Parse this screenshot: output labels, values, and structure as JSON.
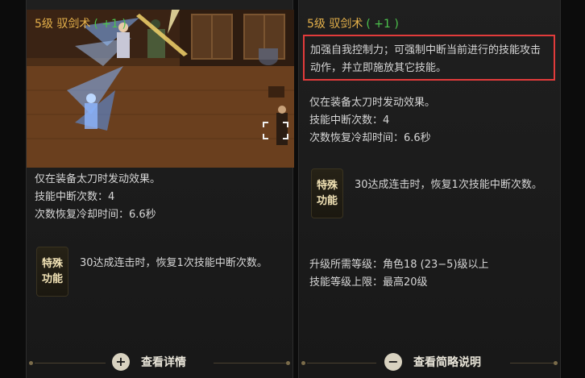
{
  "left_panel": {
    "title": {
      "name": "5级 驭剑术",
      "bonus": "( +1 )"
    },
    "effects": [
      "仅在装备太刀时发动效果。",
      "技能中断次数：4",
      "次数恢复冷却时间：6.6秒"
    ],
    "special": {
      "badge_line1": "特殊",
      "badge_line2": "功能",
      "text": "30达成连击时，恢复1次技能中断次数。"
    },
    "footer": {
      "button_label": "查看详情",
      "icon": "plus-icon"
    }
  },
  "right_panel": {
    "title": {
      "name": "5级 驭剑术",
      "bonus": "( +1 )"
    },
    "description": "加强自我控制力；可强制中断当前进行的技能攻击动作，并立即施放其它技能。",
    "effects": [
      "仅在装备太刀时发动效果。",
      "技能中断次数：4",
      "次数恢复冷却时间：6.6秒"
    ],
    "special": {
      "badge_line1": "特殊",
      "badge_line2": "功能",
      "text": "30达成连击时，恢复1次技能中断次数。"
    },
    "requirements": [
      "升级所需等级：角色18 (23−5)级以上",
      "技能等级上限：最高20级"
    ],
    "footer": {
      "button_label": "查看简略说明",
      "icon": "minus-icon"
    }
  },
  "colors": {
    "title": "#e4b04a",
    "bonus": "#4cc24c",
    "highlight": "#e23b3b",
    "text": "#d6d6d6"
  }
}
